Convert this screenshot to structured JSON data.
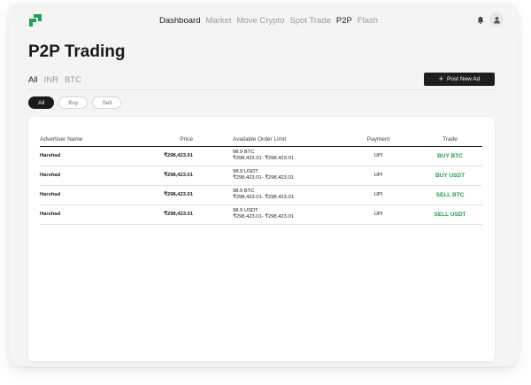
{
  "nav": {
    "items": [
      {
        "label": "Dashboard",
        "active": true
      },
      {
        "label": "Market",
        "active": false
      },
      {
        "label": "Move Crypto",
        "active": false
      },
      {
        "label": "Spot Trade",
        "active": false
      },
      {
        "label": "P2P",
        "active": true
      },
      {
        "label": "Flash",
        "active": false
      }
    ]
  },
  "page_title": "P2P Trading",
  "asset_tabs": [
    {
      "label": "All",
      "active": true
    },
    {
      "label": "INR",
      "active": false
    },
    {
      "label": "BTC",
      "active": false
    }
  ],
  "post_button": {
    "label": "Post New Ad",
    "icon": "plus-icon"
  },
  "filters": [
    {
      "label": "All",
      "active": true
    },
    {
      "label": "Buy",
      "active": false
    },
    {
      "label": "Sell",
      "active": false
    }
  ],
  "table": {
    "headers": {
      "name": "Advertiser Name",
      "price": "Price",
      "limit": "Available Order Limit",
      "payment": "Payment",
      "trade": "Trade"
    },
    "rows": [
      {
        "name": "Harshad",
        "price": "₹298,423.01",
        "available": "98.9 BTC",
        "limit": "₹298,423.01- ₹298,423.01",
        "payment": "UPI",
        "trade": "BUY BTC"
      },
      {
        "name": "Harshad",
        "price": "₹298,423.01",
        "available": "98.9 USDT",
        "limit": "₹298,423.01- ₹298,423.01",
        "payment": "UPI",
        "trade": "BUY USDT"
      },
      {
        "name": "Harshad",
        "price": "₹298,423.01",
        "available": "98.9 BTC",
        "limit": "₹298,423.01- ₹298,423.01",
        "payment": "UPI",
        "trade": "SELL BTC"
      },
      {
        "name": "Harshad",
        "price": "₹298,423.01",
        "available": "98.9 USDT",
        "limit": "₹298,423.01- ₹298,423.01",
        "payment": "UPI",
        "trade": "SELL USDT"
      }
    ]
  },
  "colors": {
    "brand": "#1aa152",
    "trade_action": "#1aa152",
    "dark": "#1a1a1a"
  },
  "icons": {
    "logo": "brand-logo-icon",
    "notifications": "bell-icon",
    "profile": "user-icon"
  }
}
